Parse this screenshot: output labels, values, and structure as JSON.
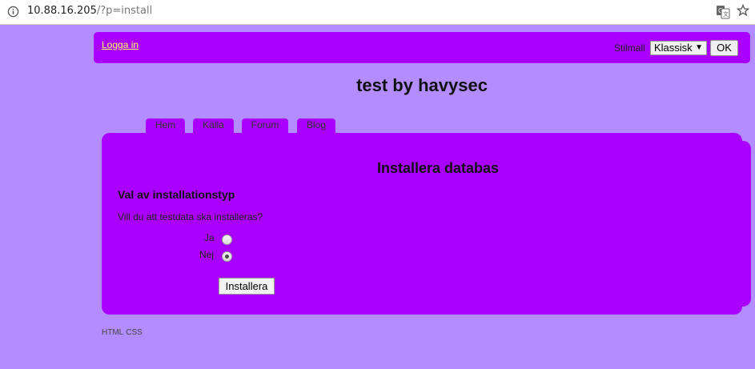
{
  "browser": {
    "url_host": "10.88.16.205",
    "url_path": "/?p=install"
  },
  "header": {
    "login_link": "Logga in",
    "style_label": "Stilmall",
    "style_selected": "Klassisk",
    "ok_label": "OK"
  },
  "site_title": "test by havysec",
  "tabs": [
    {
      "label": "Hem"
    },
    {
      "label": "Källa"
    },
    {
      "label": "Forum"
    },
    {
      "label": "Blog"
    }
  ],
  "main": {
    "title": "Installera databas",
    "section_heading": "Val av installationstyp",
    "question": "Vill du att testdata ska installeras?",
    "options": [
      {
        "label": "Ja",
        "checked": false
      },
      {
        "label": "Nej",
        "checked": true
      }
    ],
    "install_button": "Installera"
  },
  "footer": {
    "html_link": "HTML",
    "css_link": "CSS"
  },
  "colors": {
    "page_background": "#b38dff",
    "panel_purple": "#aa00ff",
    "login_link": "#ffff66"
  }
}
